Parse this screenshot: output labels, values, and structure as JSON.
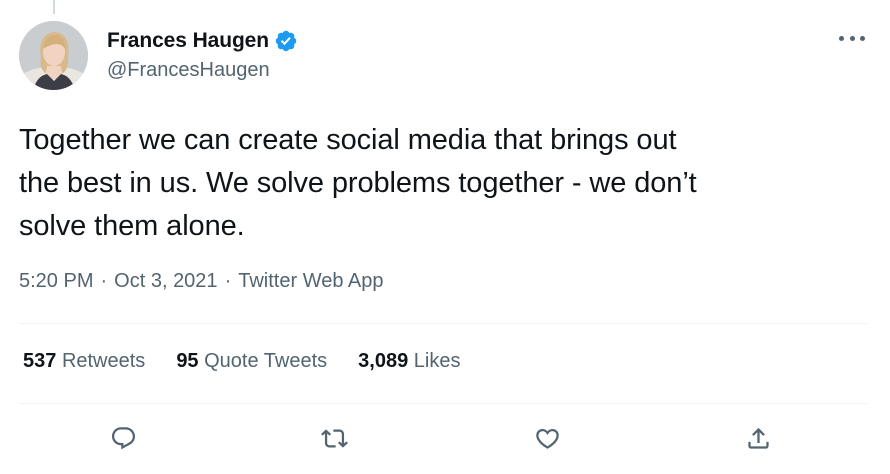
{
  "author": {
    "name": "Frances Haugen",
    "handle": "@FrancesHaugen",
    "verified": true
  },
  "tweet": {
    "text": "Together we can create social media that brings out\nthe best in us. We solve problems together - we don’t\nsolve them alone.",
    "time": "5:20 PM",
    "date": "Oct 3, 2021",
    "source": "Twitter Web App",
    "separator": "·"
  },
  "stats": {
    "retweets": {
      "count": "537",
      "label": "Retweets"
    },
    "quote_tweets": {
      "count": "95",
      "label": "Quote Tweets"
    },
    "likes": {
      "count": "3,089",
      "label": "Likes"
    }
  },
  "icons": {
    "verified": "verified-badge-icon",
    "more": "more-dots-icon",
    "reply": "reply-icon",
    "retweet": "retweet-icon",
    "like": "heart-icon",
    "share": "share-icon"
  },
  "colors": {
    "text_primary": "#0f1419",
    "text_secondary": "#536471",
    "verified_blue": "#1d9bf0",
    "divider": "#eff3f4"
  }
}
